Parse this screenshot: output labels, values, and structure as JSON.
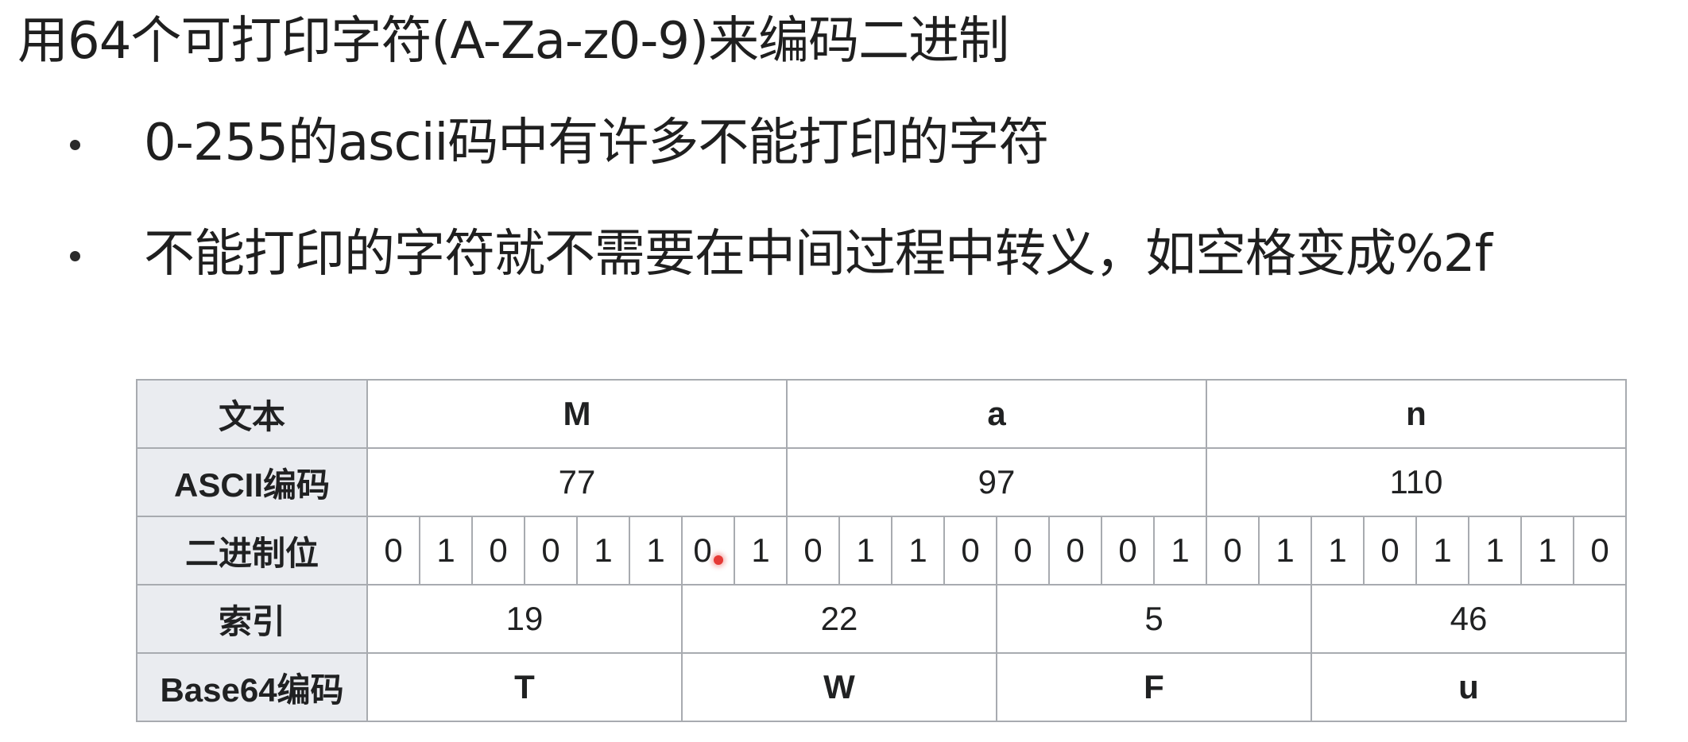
{
  "title": "用64个可打印字符(A-Za-z0-9)来编码二进制",
  "bullets": [
    "0-255的ascii码中有许多不能打印的字符",
    "不能打印的字符就不需要在中间过程中转义，如空格变成%2f"
  ],
  "table": {
    "row_headers": {
      "text": "文本",
      "ascii": "ASCII编码",
      "bits": "二进制位",
      "index": "索引",
      "base64": "Base64编码"
    },
    "text_values": [
      "M",
      "a",
      "n"
    ],
    "ascii_values": [
      "77",
      "97",
      "110"
    ],
    "bits": [
      "0",
      "1",
      "0",
      "0",
      "1",
      "1",
      "0",
      "1",
      "0",
      "1",
      "1",
      "0",
      "0",
      "0",
      "0",
      "1",
      "0",
      "1",
      "1",
      "0",
      "1",
      "1",
      "1",
      "0"
    ],
    "index_values": [
      "19",
      "22",
      "5",
      "46"
    ],
    "base64_values": [
      "T",
      "W",
      "F",
      "u"
    ]
  },
  "colors": {
    "header_bg": "#eaecf0",
    "border": "#a8abb0",
    "pointer_dot": "#e53935"
  }
}
